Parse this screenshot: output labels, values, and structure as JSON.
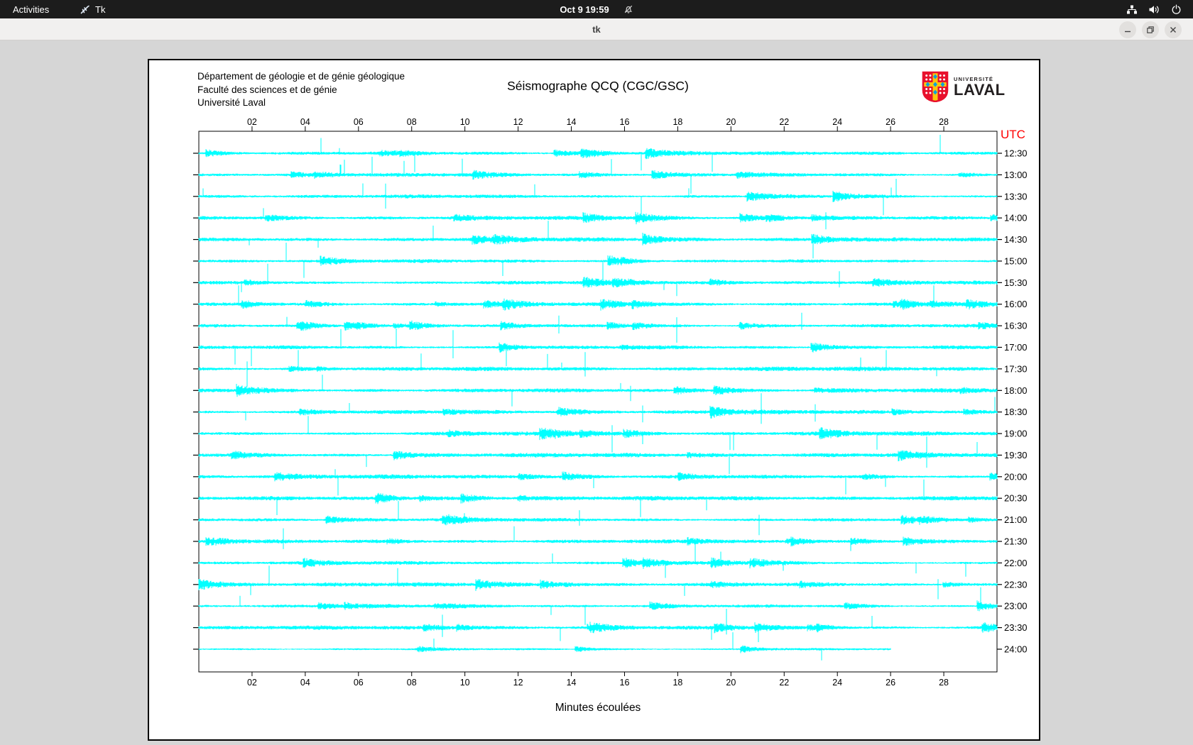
{
  "topbar": {
    "activities_label": "Activities",
    "app_name": "Tk",
    "clock": "Oct 9 19:59"
  },
  "window": {
    "title": "tk",
    "controls": [
      "minimize",
      "restore",
      "close"
    ]
  },
  "page": {
    "institution_lines": [
      "Département de géologie et de génie géologique",
      "Faculté des sciences et de génie",
      "Université Laval"
    ],
    "title": "Séismographe QCQ (CGC/GSC)",
    "logo": {
      "top": "UNIVERSITÉ",
      "bottom": "LAVAL"
    },
    "utc_label": "UTC",
    "xlabel": "Minutes écoulées"
  },
  "colors": {
    "trace": "#00ffff",
    "utc_label": "#ff0000",
    "topbar_bg": "#1c1c1c",
    "titlebar_bg": "#f1f0ef",
    "desktop_bg": "#d6d6d6",
    "page_bg": "#ffffff",
    "ink": "#000000",
    "logo_red": "#e8112d",
    "logo_yellow": "#ffc60b",
    "logo_blue": "#0ea0dc"
  },
  "chart_data": {
    "type": "line",
    "subtype": "helicorder-seismogram",
    "title": "Séismographe QCQ (CGC/GSC)",
    "xlabel": "Minutes écoulées",
    "right_axis_label": "UTC",
    "x_ticks": [
      "02",
      "04",
      "06",
      "08",
      "10",
      "12",
      "14",
      "16",
      "18",
      "20",
      "22",
      "24",
      "26",
      "28"
    ],
    "x_range_minutes": [
      0,
      30
    ],
    "minutes_per_row": 30,
    "row_interval": "00:30",
    "trace_color": "#00ffff",
    "grid": false,
    "legend": false,
    "rows": [
      {
        "utc": "12:30",
        "seed": 101,
        "act": 1.05
      },
      {
        "utc": "13:00",
        "seed": 102,
        "act": 1.0
      },
      {
        "utc": "13:30",
        "seed": 103,
        "act": 1.0
      },
      {
        "utc": "14:00",
        "seed": 104,
        "act": 1.05
      },
      {
        "utc": "14:30",
        "seed": 105,
        "act": 1.15
      },
      {
        "utc": "15:00",
        "seed": 106,
        "act": 1.0
      },
      {
        "utc": "15:30",
        "seed": 107,
        "act": 1.05
      },
      {
        "utc": "16:00",
        "seed": 108,
        "act": 0.95
      },
      {
        "utc": "16:30",
        "seed": 109,
        "act": 0.95
      },
      {
        "utc": "17:00",
        "seed": 110,
        "act": 1.1
      },
      {
        "utc": "17:30",
        "seed": 111,
        "act": 1.2
      },
      {
        "utc": "18:00",
        "seed": 112,
        "act": 1.25
      },
      {
        "utc": "18:30",
        "seed": 113,
        "act": 1.1
      },
      {
        "utc": "19:00",
        "seed": 114,
        "act": 1.15
      },
      {
        "utc": "19:30",
        "seed": 115,
        "act": 1.2
      },
      {
        "utc": "20:00",
        "seed": 116,
        "act": 1.15
      },
      {
        "utc": "20:30",
        "seed": 117,
        "act": 1.25
      },
      {
        "utc": "21:00",
        "seed": 118,
        "act": 1.0
      },
      {
        "utc": "21:30",
        "seed": 119,
        "act": 1.0
      },
      {
        "utc": "22:00",
        "seed": 120,
        "act": 0.95
      },
      {
        "utc": "22:30",
        "seed": 121,
        "act": 1.15
      },
      {
        "utc": "23:00",
        "seed": 122,
        "act": 0.9
      },
      {
        "utc": "23:30",
        "seed": 123,
        "act": 1.05
      },
      {
        "utc": "24:00",
        "seed": 124,
        "act": 0.7,
        "end_minute": 26
      }
    ]
  }
}
